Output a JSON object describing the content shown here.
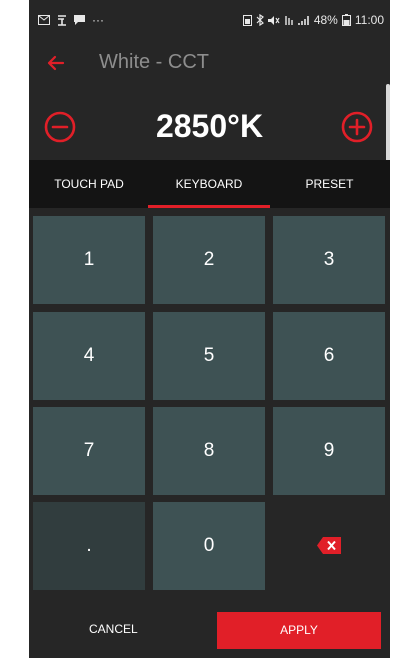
{
  "status_bar": {
    "left_icons": [
      "mail-icon",
      "signal-sim-icon",
      "message-icon"
    ],
    "ellipsis": "···",
    "battery_percent": "48%",
    "time": "11:00"
  },
  "app_bar": {
    "title": "White - CCT",
    "back_icon": "back-arrow-icon"
  },
  "temperature": {
    "value": "2850°K",
    "decrease_icon": "minus-circle-icon",
    "increase_icon": "plus-circle-icon"
  },
  "tabs": [
    {
      "label": "TOUCH PAD",
      "active": false
    },
    {
      "label": "KEYBOARD",
      "active": true
    },
    {
      "label": "PRESET",
      "active": false
    }
  ],
  "keypad": [
    [
      "1",
      "2",
      "3"
    ],
    [
      "4",
      "5",
      "6"
    ],
    [
      "7",
      "8",
      "9"
    ],
    [
      ".",
      "0",
      ""
    ]
  ],
  "actions": {
    "cancel_label": "CANCEL",
    "apply_label": "APPLY"
  },
  "colors": {
    "background": "#262626",
    "accent": "#e11f28",
    "key": "#3e5254",
    "key_dark": "#313d3e",
    "tabbar": "#141414"
  }
}
